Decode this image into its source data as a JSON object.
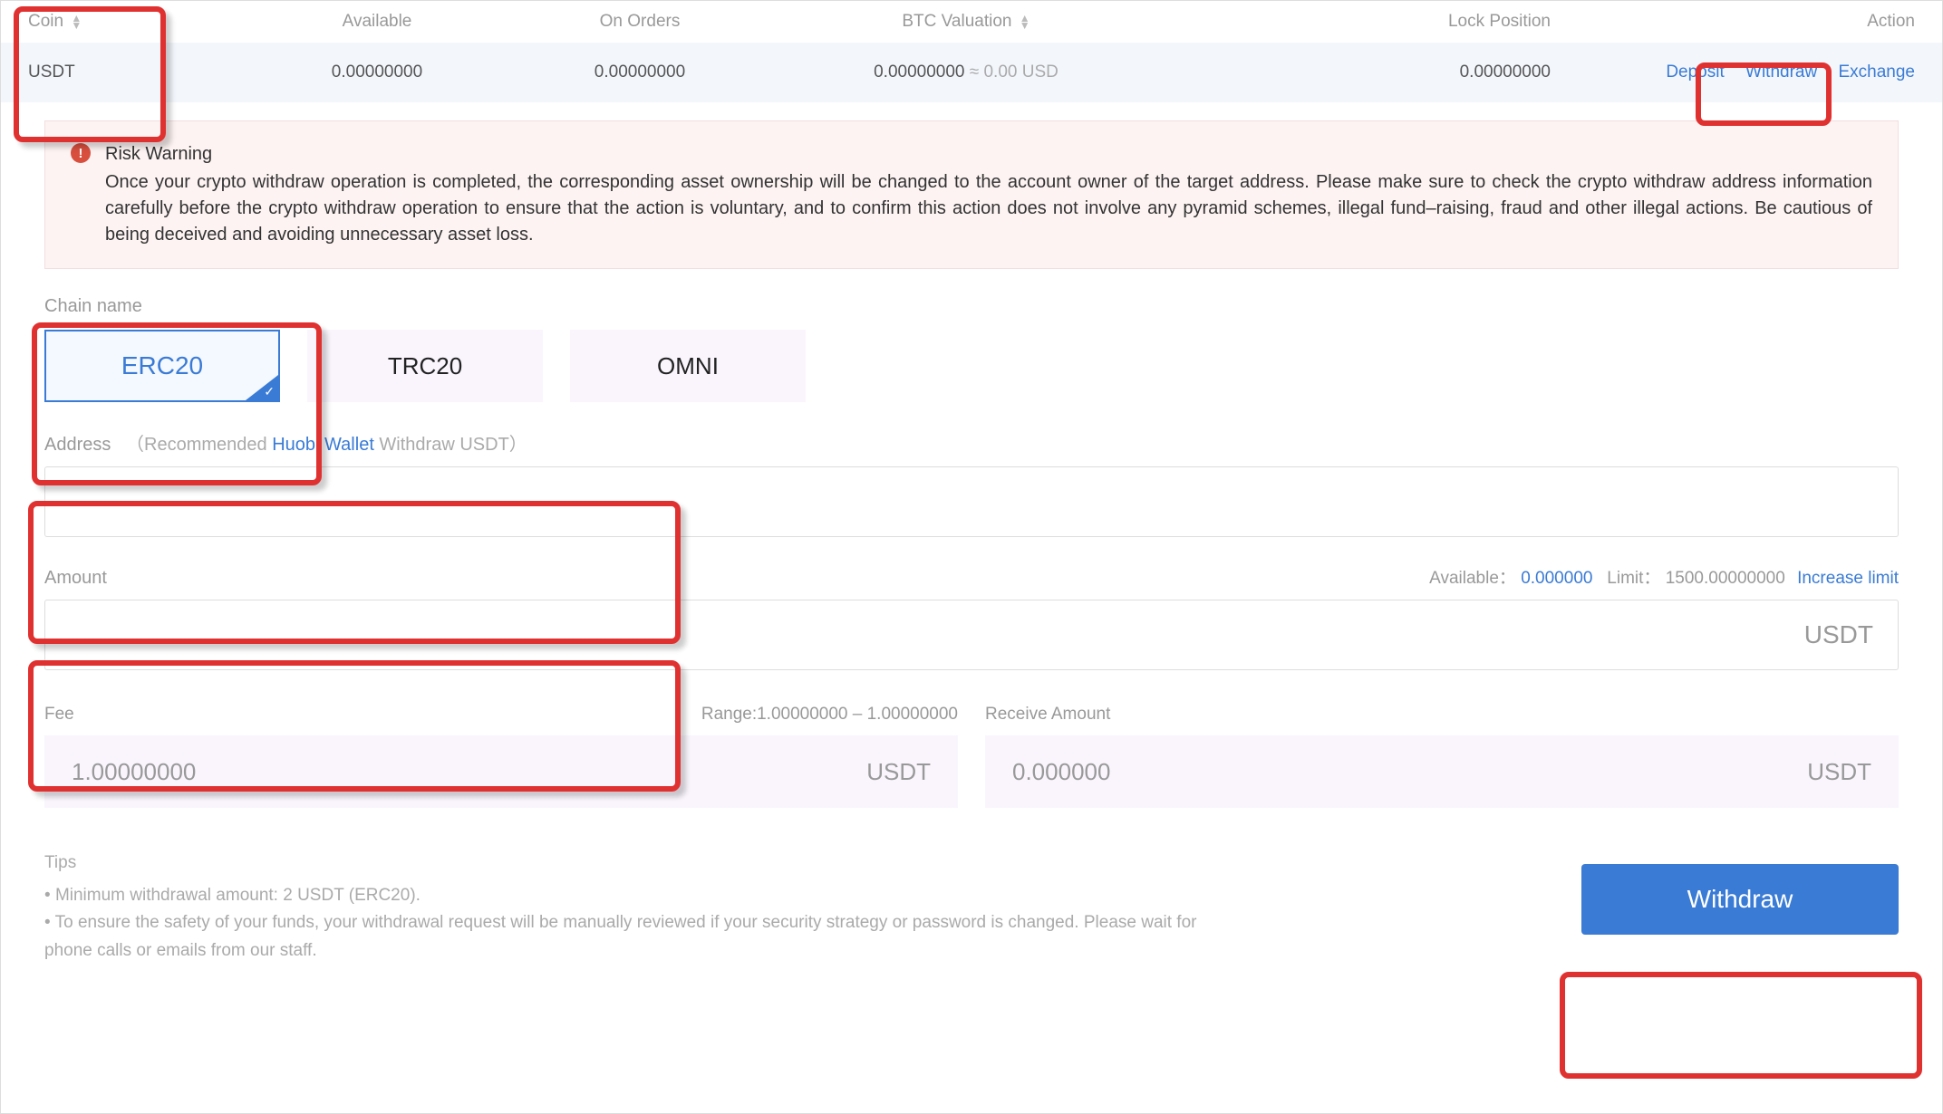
{
  "table": {
    "headers": {
      "coin": "Coin",
      "available": "Available",
      "on_orders": "On Orders",
      "btc_valuation": "BTC Valuation",
      "lock_position": "Lock Position",
      "action": "Action"
    },
    "row": {
      "coin": "USDT",
      "available": "0.00000000",
      "on_orders": "0.00000000",
      "btc_val": "0.00000000",
      "btc_usd": "≈ 0.00 USD",
      "lock": "0.00000000"
    },
    "actions": {
      "deposit": "Deposit",
      "withdraw": "Withdraw",
      "exchange": "Exchange"
    }
  },
  "risk": {
    "title": "Risk Warning",
    "body": "Once your crypto withdraw operation is completed, the corresponding asset ownership will be changed to the account owner of the target address. Please make sure to check the crypto withdraw address information carefully before the crypto withdraw operation to ensure that the action is voluntary, and to confirm this action does not involve any pyramid schemes, illegal fund–raising, fraud and other illegal actions. Be cautious of being deceived and avoiding unnecessary asset loss."
  },
  "chain": {
    "label": "Chain name",
    "options": [
      "ERC20",
      "TRC20",
      "OMNI"
    ],
    "selected": "ERC20"
  },
  "address": {
    "label": "Address",
    "rec_prefix": "（Recommended ",
    "wallet": "Huobi Wallet",
    "rec_suffix": " Withdraw USDT）",
    "value": ""
  },
  "amount": {
    "label": "Amount",
    "available_label": "Available：",
    "available_value": "0.000000",
    "limit_label": "Limit：",
    "limit_value": "1500.00000000",
    "increase": "Increase limit",
    "unit": "USDT",
    "value": ""
  },
  "fee": {
    "label": "Fee",
    "range": "Range:1.00000000 – 1.00000000",
    "value": "1.00000000",
    "unit": "USDT"
  },
  "receive": {
    "label": "Receive Amount",
    "value": "0.000000",
    "unit": "USDT"
  },
  "tips": {
    "title": "Tips",
    "items": [
      "Minimum withdrawal amount: 2 USDT (ERC20).",
      "To ensure the safety of your funds, your withdrawal request will be manually reviewed if your security strategy or password is changed. Please wait for phone calls or emails from our staff."
    ]
  },
  "withdraw_button": "Withdraw"
}
